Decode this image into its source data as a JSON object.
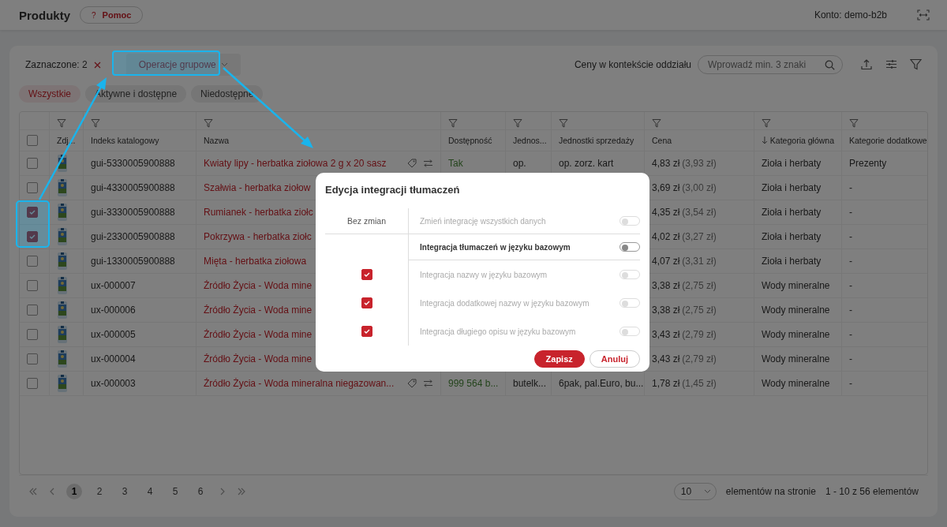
{
  "header": {
    "title": "Produkty",
    "help": {
      "icon": "?",
      "label": "Pomoc"
    },
    "account": "Konto: demo-b2b"
  },
  "toolbar": {
    "selected_label": "Zaznaczone: 2",
    "bulk_button": "Operacje grupowe",
    "price_context": "Ceny w kontekście oddziału",
    "search": {
      "placeholder": "Wprowadź min. 3 znaki"
    }
  },
  "filter_chips": [
    {
      "label": "Wszystkie",
      "selected": true
    },
    {
      "label": "Aktywne i dostępne",
      "selected": false
    },
    {
      "label": "Niedostępne",
      "selected": false
    }
  ],
  "table": {
    "select_all": {
      "checked": false
    },
    "columns": [
      {
        "label": "Zdj...",
        "sorted": false
      },
      {
        "label": "Indeks katalogowy",
        "sorted": false
      },
      {
        "label": "Nazwa",
        "sorted": false
      },
      {
        "label": "Dostępność",
        "sorted": false
      },
      {
        "label": "Jednos...",
        "sorted": false
      },
      {
        "label": "Jednostki sprzedaży",
        "sorted": false
      },
      {
        "label": "Cena",
        "sorted": false
      },
      {
        "label": "Kategoria główna",
        "sorted": true
      },
      {
        "label": "Kategorie dodatkowe",
        "sorted": false
      }
    ],
    "rows": [
      {
        "checked": false,
        "code": "gui-5330005900888",
        "name": "Kwiaty lipy - herbatka ziołowa 2 g x 20 sasz",
        "actions": true,
        "availability": "Tak",
        "unit": "op.",
        "sales_units": "op. zorz. kart",
        "price": "4,83 zł",
        "net": "(3,93 zł)",
        "category": "Zioła i herbaty",
        "extra": "Prezenty"
      },
      {
        "checked": false,
        "code": "gui-4330005900888",
        "name": "Szałwia - herbatka ziołow",
        "price": "3,69 zł",
        "net": "(3,00 zł)",
        "category": "Zioła i herbaty",
        "extra": "-"
      },
      {
        "checked": true,
        "code": "gui-3330005900888",
        "name": "Rumianek - herbatka ziołc",
        "price": "4,35 zł",
        "net": "(3,54 zł)",
        "category": "Zioła i herbaty",
        "extra": "-"
      },
      {
        "checked": true,
        "code": "gui-2330005900888",
        "name": "Pokrzywa - herbatka ziołc",
        "price": "4,02 zł",
        "net": "(3,27 zł)",
        "category": "Zioła i herbaty",
        "extra": "-"
      },
      {
        "checked": false,
        "code": "gui-1330005900888",
        "name": "Mięta - herbatka ziołowa",
        "price": "4,07 zł",
        "net": "(3,31 zł)",
        "category": "Zioła i herbaty",
        "extra": "-"
      },
      {
        "checked": false,
        "code": "ux-000007",
        "name": "Źródło Życia - Woda mine",
        "price": "3,38 zł",
        "net": "(2,75 zł)",
        "category": "Wody mineralne",
        "extra": "-"
      },
      {
        "checked": false,
        "code": "ux-000006",
        "name": "Źródło Życia - Woda mine",
        "price": "3,38 zł",
        "net": "(2,75 zł)",
        "category": "Wody mineralne",
        "extra": "-"
      },
      {
        "checked": false,
        "code": "ux-000005",
        "name": "Źródło Życia - Woda mine",
        "price": "3,43 zł",
        "net": "(2,79 zł)",
        "category": "Wody mineralne",
        "extra": "-"
      },
      {
        "checked": false,
        "code": "ux-000004",
        "name": "Źródło Życia - Woda mine",
        "price": "3,43 zł",
        "net": "(2,79 zł)",
        "category": "Wody mineralne",
        "extra": "-"
      },
      {
        "checked": false,
        "code": "ux-000003",
        "name": "Źródło Życia - Woda mineralna niegazowan...",
        "actions": true,
        "availability": "999 564 b...",
        "unit": "butelk...",
        "sales_units": "6pak, pal.Euro, bu...",
        "price": "1,78 zł",
        "net": "(1,45 zł)",
        "category": "Wody mineralne",
        "extra": "-"
      }
    ]
  },
  "pagination": {
    "pages": [
      {
        "label": "1",
        "selected": true
      },
      {
        "label": "2",
        "selected": false
      },
      {
        "label": "3",
        "selected": false
      },
      {
        "label": "4",
        "selected": false
      },
      {
        "label": "5",
        "selected": false
      },
      {
        "label": "6",
        "selected": false
      }
    ],
    "page_size": "10",
    "page_size_label": "elementów na stronie",
    "range": "1 - 10 z 56 elementów"
  },
  "modal": {
    "title": "Edycja integracji tłumaczeń",
    "left_header": "Bez zmian",
    "options": [
      {
        "label": "Zmień integrację wszystkich danych",
        "disabled": true,
        "on": false
      },
      {
        "label": "Integracja tłumaczeń w języku bazowym",
        "disabled": false,
        "on": false
      },
      {
        "label": "Integracja nazwy w języku bazowym",
        "disabled": true,
        "on": false,
        "unchanged": true
      },
      {
        "label": "Integracja dodatkowej nazwy w języku bazowym",
        "disabled": true,
        "on": false,
        "unchanged": true
      },
      {
        "label": "Integracja długiego opisu w języku bazowym",
        "disabled": true,
        "on": false,
        "unchanged": true
      }
    ],
    "buttons": [
      {
        "label": "Zapisz",
        "kind": "primary"
      },
      {
        "label": "Anuluj",
        "kind": "secondary"
      }
    ]
  }
}
